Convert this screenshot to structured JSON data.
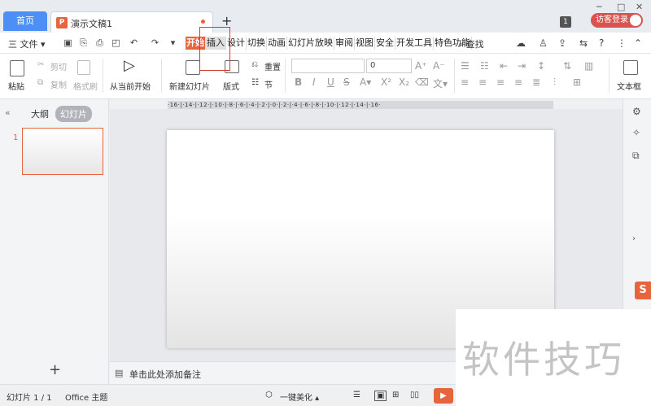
{
  "tabs": {
    "home": "首页",
    "document": "演示文稿1",
    "add": "+"
  },
  "window": {
    "badge": "1",
    "login": "访客登录",
    "minimize": "─",
    "maximize": "□",
    "close": "✕"
  },
  "menu": {
    "file": "三 文件 ▾",
    "tabs": [
      "开始",
      "插入",
      "设计",
      "切换",
      "动画",
      "幻灯片放映",
      "审阅",
      "视图",
      "安全",
      "开发工具",
      "特色功能"
    ],
    "active_tab": "开始",
    "search": "查找"
  },
  "ribbon": {
    "paste": "粘贴",
    "cut": "剪切",
    "copy": "复制",
    "format_painter": "格式刷",
    "from_current": "从当前开始",
    "new_slide": "新建幻灯片",
    "layout": "版式",
    "section": "节",
    "reset": "重置",
    "font_size": "0",
    "textbox": "文本框"
  },
  "ruler": {
    "text": "·16·|·14·|·12·|·10·|·8·|·6·|·4·|·2·|·0·|·2·|·4·|·6·|·8·|·10·|·12·|·14·|·16·"
  },
  "leftpane": {
    "collapse": "«",
    "outline": "大纲",
    "slides": "幻灯片",
    "slide_number": "1",
    "add_slide": "+"
  },
  "notes": {
    "placeholder": "单击此处添加备注"
  },
  "status": {
    "slide_info": "幻灯片 1 / 1",
    "theme": "Office 主题",
    "beautify": "一键美化 ▴",
    "play": "▶"
  },
  "watermark": {
    "text": "软件技巧"
  },
  "colors": {
    "accent": "#e8643c",
    "home_tab": "#4d8ff5",
    "login": "#d9534f",
    "highlight_box": "#d0392b"
  }
}
